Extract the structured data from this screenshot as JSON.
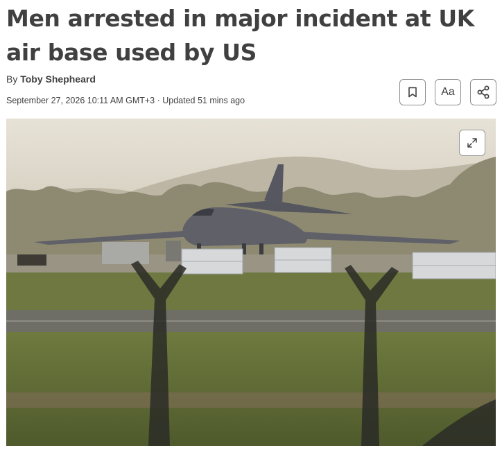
{
  "article": {
    "headline": "Men arrested in major incident at UK air base used by US",
    "byline_prefix": "By ",
    "author": "Toby Shepheard",
    "dateline": "September 27, 2026 10:11 AM GMT+3 · Updated 51 mins ago"
  },
  "toolbar": {
    "bookmark_icon": "bookmark-icon",
    "text_size_label": "Aa",
    "share_icon": "share-icon"
  },
  "photo": {
    "expand_icon": "expand-icon",
    "subject": "bomber-aircraft"
  }
}
